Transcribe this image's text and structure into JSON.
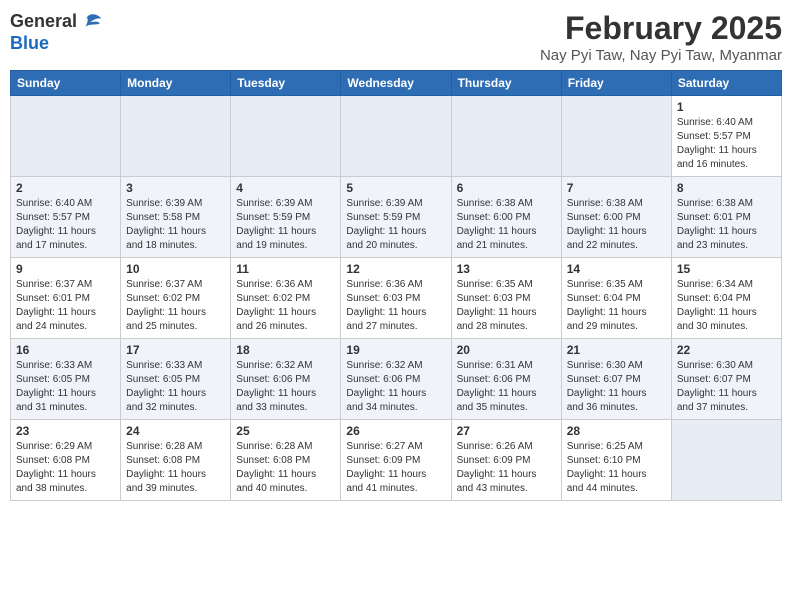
{
  "header": {
    "logo_general": "General",
    "logo_blue": "Blue",
    "month_title": "February 2025",
    "location": "Nay Pyi Taw, Nay Pyi Taw, Myanmar"
  },
  "weekdays": [
    "Sunday",
    "Monday",
    "Tuesday",
    "Wednesday",
    "Thursday",
    "Friday",
    "Saturday"
  ],
  "weeks": [
    [
      {
        "day": "",
        "info": ""
      },
      {
        "day": "",
        "info": ""
      },
      {
        "day": "",
        "info": ""
      },
      {
        "day": "",
        "info": ""
      },
      {
        "day": "",
        "info": ""
      },
      {
        "day": "",
        "info": ""
      },
      {
        "day": "1",
        "info": "Sunrise: 6:40 AM\nSunset: 5:57 PM\nDaylight: 11 hours and 16 minutes."
      }
    ],
    [
      {
        "day": "2",
        "info": "Sunrise: 6:40 AM\nSunset: 5:57 PM\nDaylight: 11 hours and 17 minutes."
      },
      {
        "day": "3",
        "info": "Sunrise: 6:39 AM\nSunset: 5:58 PM\nDaylight: 11 hours and 18 minutes."
      },
      {
        "day": "4",
        "info": "Sunrise: 6:39 AM\nSunset: 5:59 PM\nDaylight: 11 hours and 19 minutes."
      },
      {
        "day": "5",
        "info": "Sunrise: 6:39 AM\nSunset: 5:59 PM\nDaylight: 11 hours and 20 minutes."
      },
      {
        "day": "6",
        "info": "Sunrise: 6:38 AM\nSunset: 6:00 PM\nDaylight: 11 hours and 21 minutes."
      },
      {
        "day": "7",
        "info": "Sunrise: 6:38 AM\nSunset: 6:00 PM\nDaylight: 11 hours and 22 minutes."
      },
      {
        "day": "8",
        "info": "Sunrise: 6:38 AM\nSunset: 6:01 PM\nDaylight: 11 hours and 23 minutes."
      }
    ],
    [
      {
        "day": "9",
        "info": "Sunrise: 6:37 AM\nSunset: 6:01 PM\nDaylight: 11 hours and 24 minutes."
      },
      {
        "day": "10",
        "info": "Sunrise: 6:37 AM\nSunset: 6:02 PM\nDaylight: 11 hours and 25 minutes."
      },
      {
        "day": "11",
        "info": "Sunrise: 6:36 AM\nSunset: 6:02 PM\nDaylight: 11 hours and 26 minutes."
      },
      {
        "day": "12",
        "info": "Sunrise: 6:36 AM\nSunset: 6:03 PM\nDaylight: 11 hours and 27 minutes."
      },
      {
        "day": "13",
        "info": "Sunrise: 6:35 AM\nSunset: 6:03 PM\nDaylight: 11 hours and 28 minutes."
      },
      {
        "day": "14",
        "info": "Sunrise: 6:35 AM\nSunset: 6:04 PM\nDaylight: 11 hours and 29 minutes."
      },
      {
        "day": "15",
        "info": "Sunrise: 6:34 AM\nSunset: 6:04 PM\nDaylight: 11 hours and 30 minutes."
      }
    ],
    [
      {
        "day": "16",
        "info": "Sunrise: 6:33 AM\nSunset: 6:05 PM\nDaylight: 11 hours and 31 minutes."
      },
      {
        "day": "17",
        "info": "Sunrise: 6:33 AM\nSunset: 6:05 PM\nDaylight: 11 hours and 32 minutes."
      },
      {
        "day": "18",
        "info": "Sunrise: 6:32 AM\nSunset: 6:06 PM\nDaylight: 11 hours and 33 minutes."
      },
      {
        "day": "19",
        "info": "Sunrise: 6:32 AM\nSunset: 6:06 PM\nDaylight: 11 hours and 34 minutes."
      },
      {
        "day": "20",
        "info": "Sunrise: 6:31 AM\nSunset: 6:06 PM\nDaylight: 11 hours and 35 minutes."
      },
      {
        "day": "21",
        "info": "Sunrise: 6:30 AM\nSunset: 6:07 PM\nDaylight: 11 hours and 36 minutes."
      },
      {
        "day": "22",
        "info": "Sunrise: 6:30 AM\nSunset: 6:07 PM\nDaylight: 11 hours and 37 minutes."
      }
    ],
    [
      {
        "day": "23",
        "info": "Sunrise: 6:29 AM\nSunset: 6:08 PM\nDaylight: 11 hours and 38 minutes."
      },
      {
        "day": "24",
        "info": "Sunrise: 6:28 AM\nSunset: 6:08 PM\nDaylight: 11 hours and 39 minutes."
      },
      {
        "day": "25",
        "info": "Sunrise: 6:28 AM\nSunset: 6:08 PM\nDaylight: 11 hours and 40 minutes."
      },
      {
        "day": "26",
        "info": "Sunrise: 6:27 AM\nSunset: 6:09 PM\nDaylight: 11 hours and 41 minutes."
      },
      {
        "day": "27",
        "info": "Sunrise: 6:26 AM\nSunset: 6:09 PM\nDaylight: 11 hours and 43 minutes."
      },
      {
        "day": "28",
        "info": "Sunrise: 6:25 AM\nSunset: 6:10 PM\nDaylight: 11 hours and 44 minutes."
      },
      {
        "day": "",
        "info": ""
      }
    ]
  ]
}
